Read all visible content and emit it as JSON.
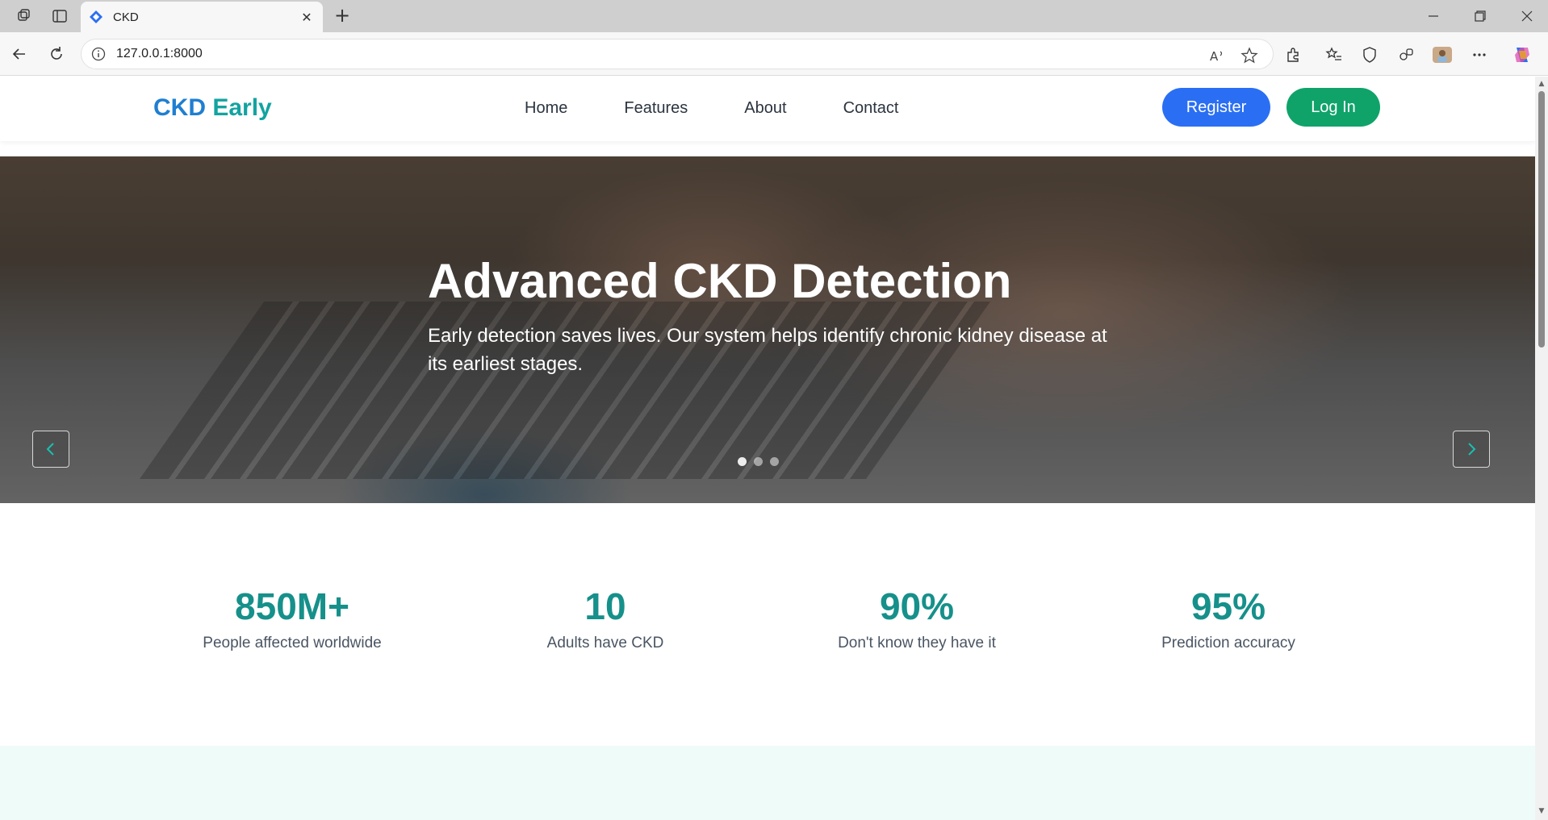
{
  "browser": {
    "tab_title": "CKD",
    "url": "127.0.0.1:8000"
  },
  "site": {
    "logo_part1": "CKD",
    "logo_part2": "Early",
    "nav": [
      "Home",
      "Features",
      "About",
      "Contact"
    ],
    "register_label": "Register",
    "login_label": "Log In"
  },
  "hero": {
    "title": "Advanced CKD Detection",
    "subtitle": "Early detection saves lives. Our system helps identify chronic kidney disease at its earliest stages.",
    "slides": 3,
    "active_slide": 1
  },
  "stats": [
    {
      "value": "850M+",
      "label": "People affected worldwide"
    },
    {
      "value": "10",
      "label": "Adults have CKD"
    },
    {
      "value": "90%",
      "label": "Don't know they have it"
    },
    {
      "value": "95%",
      "label": "Prediction accuracy"
    }
  ],
  "colors": {
    "accent_blue": "#2a6ff3",
    "accent_green": "#0fa36a",
    "stat_teal": "#16908a",
    "logo_blue": "#1f7fd1",
    "logo_teal": "#13a3a0"
  }
}
